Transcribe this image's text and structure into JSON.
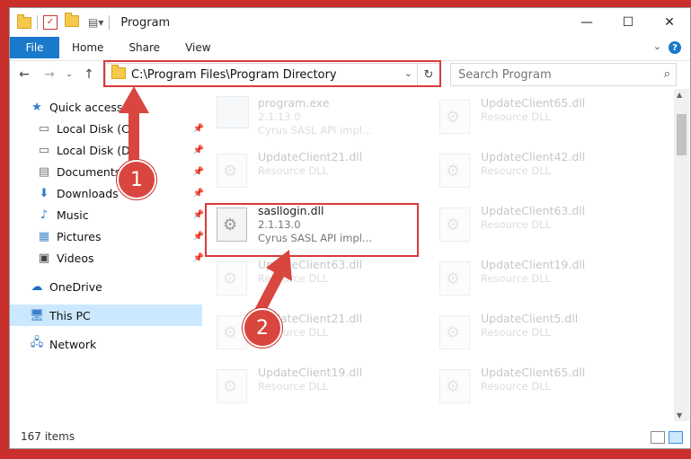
{
  "window": {
    "title": "Program"
  },
  "ribbon": {
    "tabs": [
      "File",
      "Home",
      "Share",
      "View"
    ],
    "help": "?"
  },
  "nav": {
    "address": "C:\\Program Files\\Program Directory",
    "search_placeholder": "Search Program"
  },
  "sidebar": {
    "items": [
      {
        "label": "Quick access",
        "icon": "star-icon"
      },
      {
        "label": "Local Disk (C:)",
        "icon": "drive-icon",
        "pinned": true
      },
      {
        "label": "Local Disk (D:)",
        "icon": "drive-icon",
        "pinned": true
      },
      {
        "label": "Documents",
        "icon": "documents-icon",
        "pinned": true
      },
      {
        "label": "Downloads",
        "icon": "download-icon",
        "pinned": true
      },
      {
        "label": "Music",
        "icon": "music-icon",
        "pinned": true
      },
      {
        "label": "Pictures",
        "icon": "pictures-icon",
        "pinned": true
      },
      {
        "label": "Videos",
        "icon": "videos-icon",
        "pinned": true
      },
      {
        "label": "OneDrive",
        "icon": "cloud-icon"
      },
      {
        "label": "This PC",
        "icon": "computer-icon",
        "selected": true
      },
      {
        "label": "Network",
        "icon": "network-icon"
      }
    ]
  },
  "files": {
    "left": [
      {
        "name": "program.exe",
        "line2": "2.1.13.0",
        "line3": "Cyrus SASL API impl...",
        "faded": true,
        "type": "exe"
      },
      {
        "name": "UpdateClient21.dll",
        "line2": "Resource DLL",
        "faded": true
      },
      {
        "name": "sasllogin.dll",
        "line2": "2.1.13.0",
        "line3": "Cyrus SASL API impl...",
        "faded": false,
        "highlighted": true
      },
      {
        "name": "UpdateClient63.dll",
        "line2": "Resource DLL",
        "faded": true
      },
      {
        "name": "UpdateClient21.dll",
        "line2": "Resource DLL",
        "faded": true
      },
      {
        "name": "UpdateClient19.dll",
        "line2": "Resource DLL",
        "faded": true
      }
    ],
    "right": [
      {
        "name": "UpdateClient65.dll",
        "line2": "Resource DLL"
      },
      {
        "name": "UpdateClient42.dll",
        "line2": "Resource DLL"
      },
      {
        "name": "UpdateClient63.dll",
        "line2": "Resource DLL"
      },
      {
        "name": "UpdateClient19.dll",
        "line2": "Resource DLL"
      },
      {
        "name": "UpdateClient5.dll",
        "line2": "Resource DLL"
      },
      {
        "name": "UpdateClient65.dll",
        "line2": "Resource DLL"
      }
    ]
  },
  "status": {
    "items": "167 items"
  },
  "annotations": {
    "step1": "1",
    "step2": "2",
    "accent": "#d9453f"
  }
}
